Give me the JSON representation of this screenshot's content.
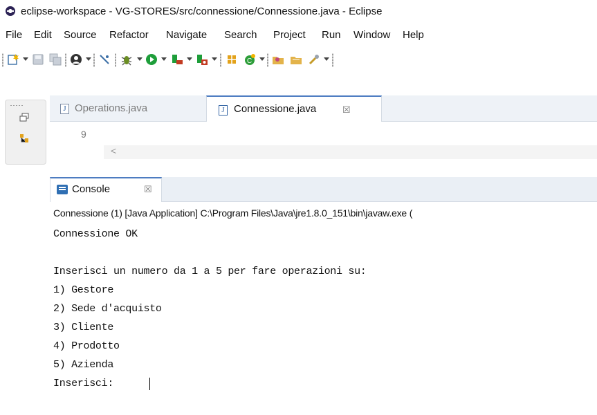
{
  "window": {
    "title": "eclipse-workspace - VG-STORES/src/connessione/Connessione.java - Eclipse"
  },
  "menu": [
    "File",
    "Edit",
    "Source",
    "Refactor",
    "Navigate",
    "Search",
    "Project",
    "Run",
    "Window",
    "Help"
  ],
  "editor": {
    "tabs": [
      {
        "label": "Operations.java",
        "active": false
      },
      {
        "label": "Connessione.java",
        "active": true
      }
    ],
    "close_glyph": "☒",
    "line_number": "9",
    "scroll_arrow": "<"
  },
  "console": {
    "tab_label": "Console",
    "close_glyph": "☒",
    "status": "Connessione (1) [Java Application] C:\\Program Files\\Java\\jre1.8.0_151\\bin\\javaw.exe (",
    "lines": [
      "Connessione OK",
      "",
      "Inserisci un numero da 1 a 5 per fare operazioni su:",
      "1) Gestore",
      "2) Sede d'acquisto",
      "3) Cliente",
      "4) Prodotto",
      "5) Azienda",
      "Inserisci: "
    ]
  },
  "colors": {
    "accent": "#4d7cc1",
    "tab_background": "#eef2f7"
  }
}
